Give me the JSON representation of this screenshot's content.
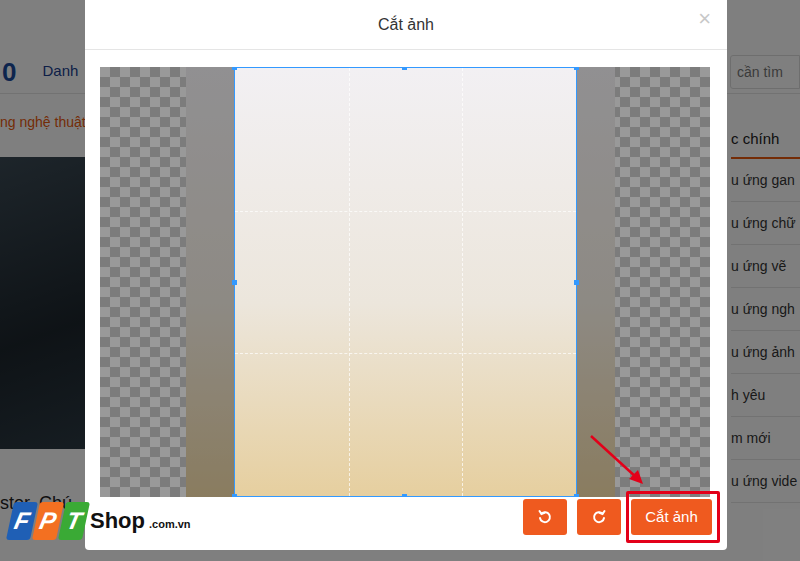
{
  "page": {
    "logo": "0",
    "nav": "Danh",
    "search": {
      "placeholder": "cần tìm"
    },
    "breadcrumb": "ng nghệ thuật",
    "sidebar": {
      "title": "c chính",
      "items": [
        "u ứng gan",
        "u ứng chữ",
        "u ứng vẽ",
        "u ứng ngh",
        "u ứng ảnh",
        "h yêu",
        "m mới",
        "u ứng vide"
      ]
    },
    "caption": "ster. Chú"
  },
  "dialog": {
    "title": "Cắt ảnh",
    "close": "×",
    "buttons": [
      {
        "kind": "rotate-left",
        "highlighted": false
      },
      {
        "kind": "rotate-right",
        "highlighted": false
      },
      {
        "kind": "text",
        "label": "Cắt ảnh",
        "highlighted": true
      }
    ]
  },
  "watermark": {
    "letters": [
      {
        "text": "F",
        "color": "#1f5fb5"
      },
      {
        "text": "P",
        "color": "#f37021"
      },
      {
        "text": "T",
        "color": "#3aaa35"
      }
    ],
    "shop": "Shop",
    "domain": ".com.vn"
  }
}
